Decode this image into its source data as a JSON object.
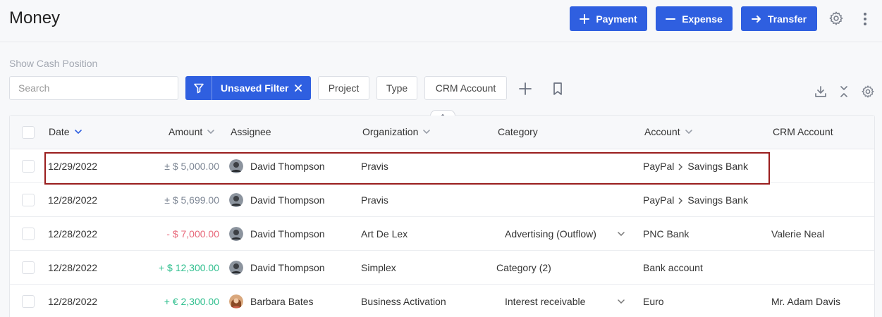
{
  "header": {
    "title": "Money",
    "payment_label": "Payment",
    "expense_label": "Expense",
    "transfer_label": "Transfer"
  },
  "filters": {
    "show_cash_label": "Show Cash Position",
    "search_placeholder": "Search",
    "active_filter_label": "Unsaved Filter",
    "chips": [
      "Project",
      "Type",
      "CRM Account"
    ]
  },
  "table": {
    "columns": {
      "date": "Date",
      "amount": "Amount",
      "assignee": "Assignee",
      "organization": "Organization",
      "category": "Category",
      "account": "Account",
      "crm_account": "CRM Account"
    },
    "rows": [
      {
        "date": "12/29/2022",
        "amount": "± $ 5,000.00",
        "assignee": "David Thompson",
        "organization": "Pravis",
        "category": "",
        "account_from": "PayPal",
        "account_to": "Savings Bank",
        "crm_account": ""
      },
      {
        "date": "12/28/2022",
        "amount": "± $ 5,699.00",
        "assignee": "David Thompson",
        "organization": "Pravis",
        "category": "",
        "account_from": "PayPal",
        "account_to": "Savings Bank",
        "crm_account": ""
      },
      {
        "date": "12/28/2022",
        "amount": "- $ 7,000.00",
        "assignee": "David Thompson",
        "organization": "Art De Lex",
        "category": "Advertising (Outflow)",
        "account_from": "PNC Bank",
        "account_to": "",
        "crm_account": "Valerie Neal"
      },
      {
        "date": "12/28/2022",
        "amount": "+ $ 12,300.00",
        "assignee": "David Thompson",
        "organization": "Simplex",
        "category": "Category (2)",
        "account_from": "Bank account",
        "account_to": "",
        "crm_account": ""
      },
      {
        "date": "12/28/2022",
        "amount": "+ € 2,300.00",
        "assignee": "Barbara Bates",
        "organization": "Business Activation",
        "category": "Interest receivable",
        "account_from": "Euro",
        "account_to": "",
        "crm_account": "Mr. Adam Davis"
      }
    ]
  },
  "colors": {
    "primary": "#2f5fe0",
    "negative": "#e8687a",
    "positive": "#2fbf8e",
    "neutral": "#7e8795",
    "selection_outline": "#9a1e1e"
  }
}
